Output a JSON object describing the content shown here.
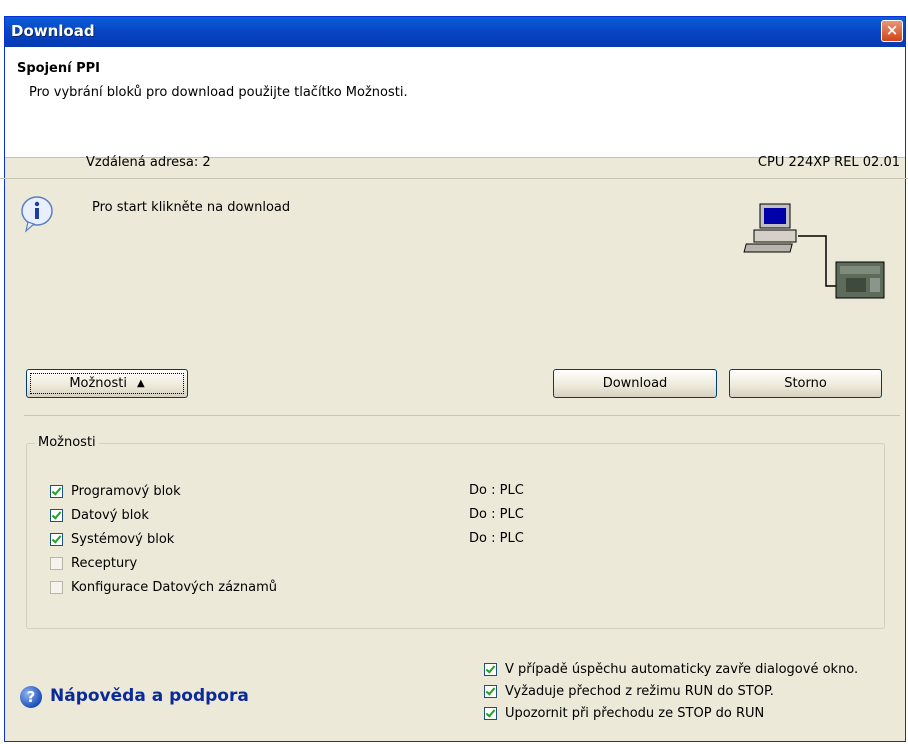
{
  "window": {
    "title": "Download",
    "close_symbol": "×"
  },
  "header": {
    "title": "Spojení PPI",
    "subtitle": "Pro vybrání bloků pro download použijte tlačítko Možnosti."
  },
  "connection": {
    "remote_address": "Vzdálená adresa: 2",
    "cpu_info": "CPU 224XP REL 02.01",
    "message": "Pro start klikněte na download"
  },
  "buttons": {
    "options": "Možnosti",
    "options_arrow": "▲",
    "download": "Download",
    "cancel": "Storno"
  },
  "options_group": {
    "label": "Možnosti",
    "items": [
      {
        "label": "Programový blok",
        "checked": true,
        "target": "Do : PLC"
      },
      {
        "label": "Datový blok",
        "checked": true,
        "target": "Do : PLC"
      },
      {
        "label": "Systémový blok",
        "checked": true,
        "target": "Do : PLC"
      },
      {
        "label": "Receptury",
        "checked": false,
        "target": ""
      },
      {
        "label": "Konfigurace Datových záznamů",
        "checked": false,
        "target": ""
      }
    ]
  },
  "footer_options": [
    {
      "label": "V případě úspěchu automaticky zavře dialogové okno.",
      "checked": true
    },
    {
      "label": "Vyžaduje přechod z režimu RUN do STOP.",
      "checked": true
    },
    {
      "label": "Upozornit při přechodu ze STOP do RUN",
      "checked": true
    }
  ],
  "help": {
    "label": "Nápověda a podpora",
    "icon_symbol": "?"
  },
  "icons": {
    "info": "info-icon",
    "pc_plc": "pc-plc-connection-icon",
    "help": "help-icon"
  }
}
